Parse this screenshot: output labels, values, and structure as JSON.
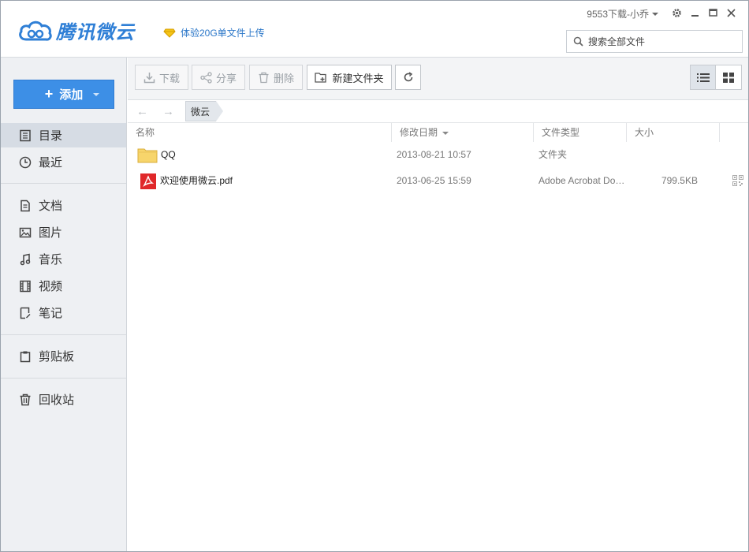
{
  "header": {
    "app_name": "腾讯微云",
    "promo_text": "体验20G单文件上传",
    "user_name": "9553下载-小乔",
    "search_placeholder": "搜索全部文件"
  },
  "sidebar": {
    "add_label": "添加",
    "items": [
      {
        "label": "目录",
        "icon": "catalog-icon",
        "active": true
      },
      {
        "label": "最近",
        "icon": "clock-icon"
      },
      {
        "label": "文档",
        "icon": "document-icon"
      },
      {
        "label": "图片",
        "icon": "image-icon"
      },
      {
        "label": "音乐",
        "icon": "music-icon"
      },
      {
        "label": "视频",
        "icon": "video-icon"
      },
      {
        "label": "笔记",
        "icon": "note-icon"
      },
      {
        "label": "剪贴板",
        "icon": "clipboard-icon"
      },
      {
        "label": "回收站",
        "icon": "trash-icon"
      }
    ]
  },
  "toolbar": {
    "download_label": "下载",
    "share_label": "分享",
    "delete_label": "删除",
    "new_folder_label": "新建文件夹"
  },
  "breadcrumb": {
    "current": "微云"
  },
  "table": {
    "columns": [
      "名称",
      "修改日期",
      "文件类型",
      "大小"
    ],
    "rows": [
      {
        "name": "QQ",
        "date": "2013-08-21 10:57",
        "type": "文件夹",
        "size": "",
        "icon": "folder-icon"
      },
      {
        "name": "欢迎使用微云.pdf",
        "date": "2013-06-25 15:59",
        "type": "Adobe Acrobat Docu...",
        "size": "799.5KB",
        "icon": "pdf-icon"
      }
    ]
  },
  "colors": {
    "accent": "#3d8fe6",
    "logo": "#2f7fd6",
    "pdf_red": "#e0282a",
    "folder_yellow": "#f7d56b"
  }
}
